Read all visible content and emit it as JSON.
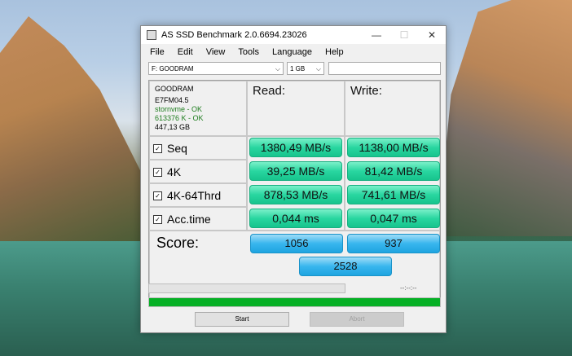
{
  "window": {
    "title": "AS SSD Benchmark 2.0.6694.23026",
    "minimize": "—",
    "maximize": "☐",
    "close": "✕"
  },
  "menu": [
    "File",
    "Edit",
    "View",
    "Tools",
    "Language",
    "Help"
  ],
  "toolbar": {
    "drive": "F: GOODRAM",
    "size": "1 GB",
    "field_value": ""
  },
  "drive_info": {
    "name": "GOODRAM",
    "firmware": "E7FM04.5",
    "driver_status": "stornvme - OK",
    "alignment_status": "613376 K - OK",
    "capacity": "447,13 GB"
  },
  "headers": {
    "read": "Read:",
    "write": "Write:"
  },
  "rows": [
    {
      "label": "Seq",
      "read": "1380,49 MB/s",
      "write": "1138,00 MB/s"
    },
    {
      "label": "4K",
      "read": "39,25 MB/s",
      "write": "81,42 MB/s"
    },
    {
      "label": "4K-64Thrd",
      "read": "878,53 MB/s",
      "write": "741,61 MB/s"
    },
    {
      "label": "Acc.time",
      "read": "0,044 ms",
      "write": "0,047 ms"
    }
  ],
  "score": {
    "label": "Score:",
    "read": "1056",
    "write": "937",
    "total": "2528"
  },
  "status": {
    "elapsed": "--:--:--",
    "progress": 0,
    "overall_progress": 1.0
  },
  "buttons": {
    "start": "Start",
    "abort": "Abort"
  },
  "colors": {
    "result_green": "#29d6a0",
    "score_blue": "#38b6ee",
    "progress_green": "#06b025",
    "ok_text": "#1e7d1e"
  }
}
